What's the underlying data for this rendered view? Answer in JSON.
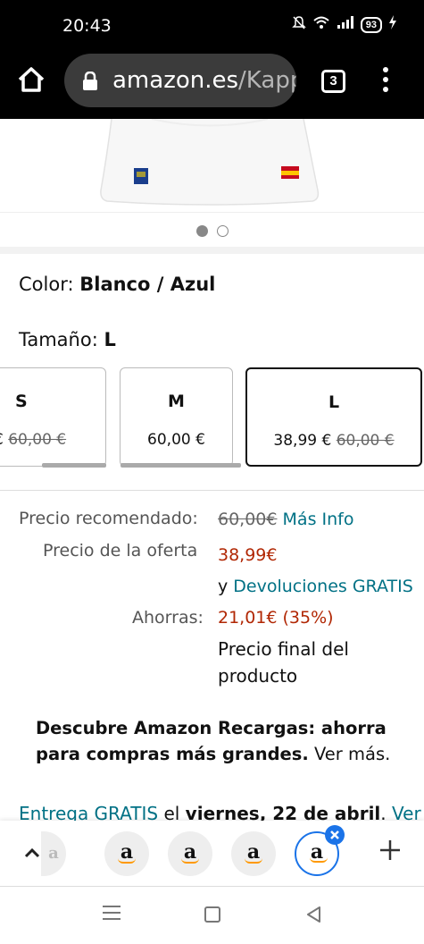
{
  "status_bar": {
    "time": "20:43",
    "battery": "93"
  },
  "browser": {
    "url_domain": "amazon.es",
    "url_path": "/Kapp",
    "tab_count": "3"
  },
  "product": {
    "color_label": "Color:",
    "color_value": "Blanco / Azul",
    "size_label": "Tamaño:",
    "size_value": "L",
    "carousel": {
      "total": 2,
      "active_index": 0
    },
    "sizes": [
      {
        "name": "S",
        "price": "€",
        "old_price": "60,00 €"
      },
      {
        "name": "M",
        "price": "60,00 €",
        "old_price": ""
      },
      {
        "name": "L",
        "price": "38,99 €",
        "old_price": "60,00 €",
        "selected": true
      }
    ]
  },
  "pricing": {
    "recommended_label": "Precio recomendado:",
    "recommended_value": "60,00€",
    "more_info": "Más Info",
    "offer_label": "Precio de la oferta",
    "offer_value": "38,99€",
    "returns_prefix": "y",
    "returns_link": "Devoluciones GRATIS",
    "savings_label": "Ahorras:",
    "savings_value": "21,01€ (35%)",
    "final_price_note_1": "Precio final del",
    "final_price_note_2": "producto"
  },
  "recargas": {
    "bold": "Descubre Amazon Recargas: ahorra para compras más grandes.",
    "link": "Ver más."
  },
  "delivery": {
    "prefix": "Entrega GRATIS",
    "middle": "el",
    "date": "viernes, 22 de abril",
    "link": "Ver"
  },
  "tabs": {
    "tab_glyph": "a"
  },
  "colors": {
    "offer_red": "#b12704",
    "link_teal": "#007185",
    "tab_active": "#1a73e8"
  }
}
